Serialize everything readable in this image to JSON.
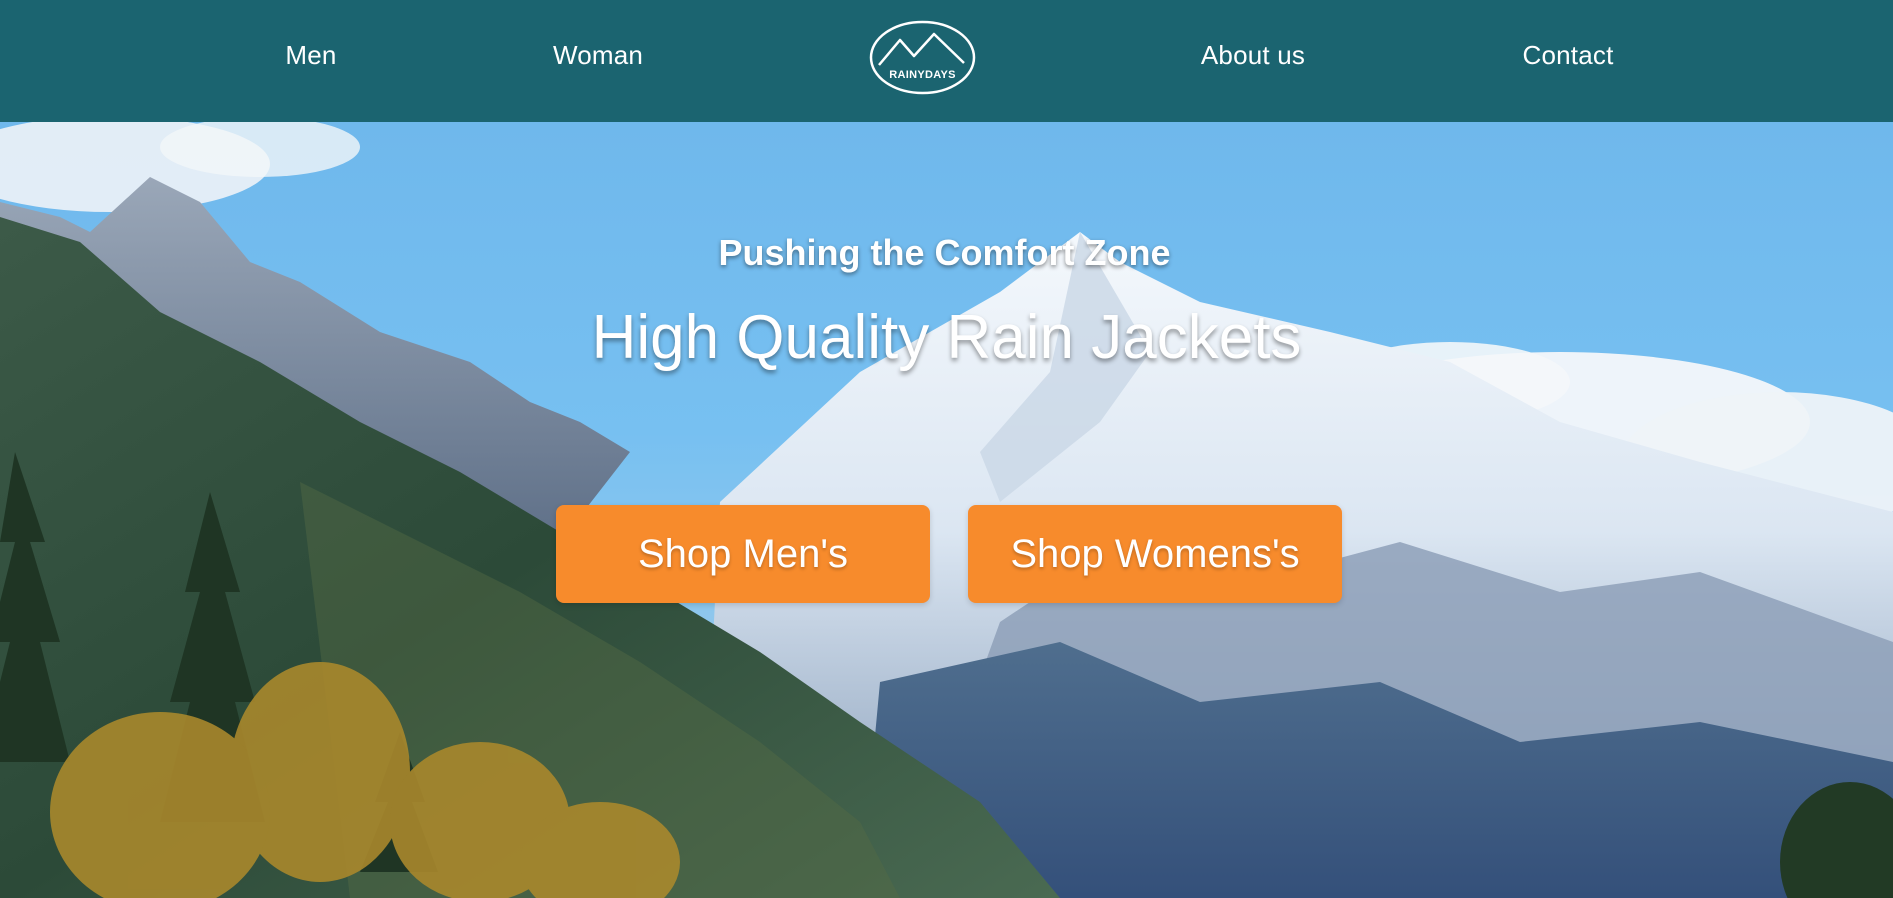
{
  "nav": {
    "items": [
      {
        "label": "Men"
      },
      {
        "label": "Woman"
      },
      {
        "label": "About us"
      },
      {
        "label": "Contact"
      }
    ],
    "logo_text": "RAINYDAYS",
    "background": "#1b6470"
  },
  "hero": {
    "subtitle": "Pushing the Comfort Zone",
    "title": "High Quality Rain Jackets",
    "buttons": [
      {
        "label": "Shop Men's"
      },
      {
        "label": "Shop Womens's"
      }
    ],
    "button_color": "#f78b2c"
  }
}
